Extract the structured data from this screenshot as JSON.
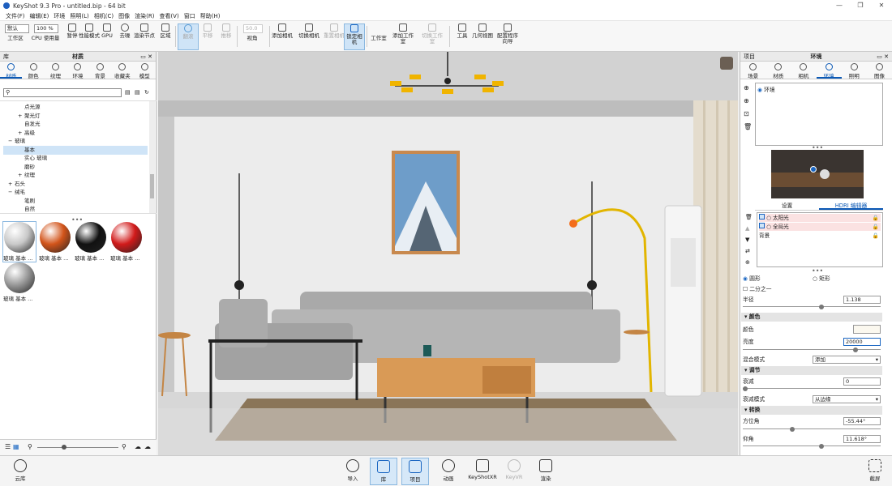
{
  "app": {
    "title": "KeyShot 9.3 Pro  - untitled.bip  - 64 bit"
  },
  "window_controls": [
    "—",
    "❐",
    "✕"
  ],
  "menu": [
    "文件(F)",
    "编辑(E)",
    "环境",
    "照明(L)",
    "相机(C)",
    "图像",
    "渲染(R)",
    "查看(V)",
    "窗口",
    "帮助(H)"
  ],
  "toolbar": {
    "preset": "默认",
    "zoom": "100 %",
    "items": [
      {
        "label": "工作区",
        "icon": "workspace-icon"
      },
      {
        "label": "CPU 使用量",
        "icon": "cpu-icon"
      },
      {
        "label": "暂停",
        "icon": "pause-icon"
      },
      {
        "label": "性能模式",
        "icon": "performance-icon"
      },
      {
        "label": "GPU",
        "icon": "gpu-icon"
      },
      {
        "label": "去噪",
        "icon": "denoise-icon"
      },
      {
        "label": "渲染节点",
        "icon": "render-nodes-icon"
      },
      {
        "label": "区域",
        "icon": "region-icon"
      },
      {
        "label": "翻滚",
        "icon": "tumble-icon"
      },
      {
        "label": "平移",
        "icon": "pan-icon"
      },
      {
        "label": "推移",
        "icon": "dolly-icon"
      },
      {
        "label": "视角",
        "icon": "perspective-icon"
      },
      {
        "label": "添加相机",
        "icon": "add-camera-icon"
      },
      {
        "label": "切换相机",
        "icon": "switch-camera-icon"
      },
      {
        "label": "重置相机",
        "icon": "reset-camera-icon"
      },
      {
        "label": "锁定相机",
        "icon": "lock-camera-icon"
      },
      {
        "label": "工作室",
        "icon": "studio-icon"
      },
      {
        "label": "添加工作室",
        "icon": "add-studio-icon"
      },
      {
        "label": "切换工作室",
        "icon": "switch-studio-icon"
      },
      {
        "label": "工具",
        "icon": "tools-icon"
      },
      {
        "label": "几何视图",
        "icon": "geometry-view-icon"
      },
      {
        "label": "配置程序向导",
        "icon": "configurator-wizard-icon"
      }
    ],
    "fov_value": "50.0"
  },
  "library": {
    "header_left": "库",
    "title": "材质",
    "tabs": [
      "材质",
      "颜色",
      "纹理",
      "环境",
      "背景",
      "收藏夹",
      "模型"
    ],
    "tree": [
      {
        "label": "点光源",
        "level": 2,
        "expander": ""
      },
      {
        "label": "聚光灯",
        "level": 2,
        "expander": "+"
      },
      {
        "label": "自发光",
        "level": 2,
        "expander": ""
      },
      {
        "label": "高级",
        "level": 2,
        "expander": "+"
      },
      {
        "label": "玻璃",
        "level": 1,
        "expander": "−"
      },
      {
        "label": "基本",
        "level": 2,
        "expander": "",
        "selected": true
      },
      {
        "label": "实心 玻璃",
        "level": 2,
        "expander": ""
      },
      {
        "label": "磨砂",
        "level": 2,
        "expander": ""
      },
      {
        "label": "纹理",
        "level": 2,
        "expander": "+"
      },
      {
        "label": "石头",
        "level": 1,
        "expander": "+"
      },
      {
        "label": "绒毛",
        "level": 1,
        "expander": "−"
      },
      {
        "label": "笔刷",
        "level": 2,
        "expander": ""
      },
      {
        "label": "自然",
        "level": 2,
        "expander": ""
      }
    ],
    "thumbs": [
      {
        "label": "玻璃 基本 ...",
        "color": "#c9c9c9"
      },
      {
        "label": "玻璃 基本 ...",
        "color": "#d2541a"
      },
      {
        "label": "玻璃 基本 ...",
        "color": "#111111"
      },
      {
        "label": "玻璃 基本 ...",
        "color": "#d11a1a"
      },
      {
        "label": "玻璃 基本 ...",
        "color": "#9a9a9a"
      }
    ]
  },
  "project": {
    "header_left": "项目",
    "title": "环境",
    "tabs": [
      "场景",
      "材质",
      "相机",
      "环境",
      "照明",
      "图像"
    ],
    "env_list": [
      "环境"
    ],
    "subtabs": [
      "设置",
      "HDRI 编辑器"
    ],
    "pins": [
      "太阳光",
      "全局光",
      "背景"
    ],
    "shape": {
      "circle": "圆形",
      "rect": "矩形",
      "half": "二分之一"
    },
    "radius_label": "半径",
    "radius_value": "1.138",
    "color_section": "颜色",
    "color_label": "颜色",
    "brightness_label": "亮度",
    "brightness_value": "20000",
    "blend_label": "混合模式",
    "blend_value": "添加",
    "adjust_section": "调节",
    "falloff_label": "衰减",
    "falloff_value": "0",
    "falloff_mode_label": "衰减模式",
    "falloff_mode_value": "从边缘",
    "transform_section": "转换",
    "azimuth_label": "方位角",
    "azimuth_value": "-55.44°",
    "elevation_label": "仰角",
    "elevation_value": "11.618°"
  },
  "bottom": {
    "cloud": "云库",
    "items": [
      {
        "label": "导入",
        "icon": "import-icon"
      },
      {
        "label": "库",
        "icon": "library-icon"
      },
      {
        "label": "项目",
        "icon": "project-icon"
      },
      {
        "label": "动画",
        "icon": "animation-icon"
      },
      {
        "label": "KeyShotXR",
        "icon": "keyshotxr-icon"
      },
      {
        "label": "KeyVR",
        "icon": "keyvr-icon"
      },
      {
        "label": "渲染",
        "icon": "render-icon"
      }
    ],
    "screenshot": "截屏"
  }
}
